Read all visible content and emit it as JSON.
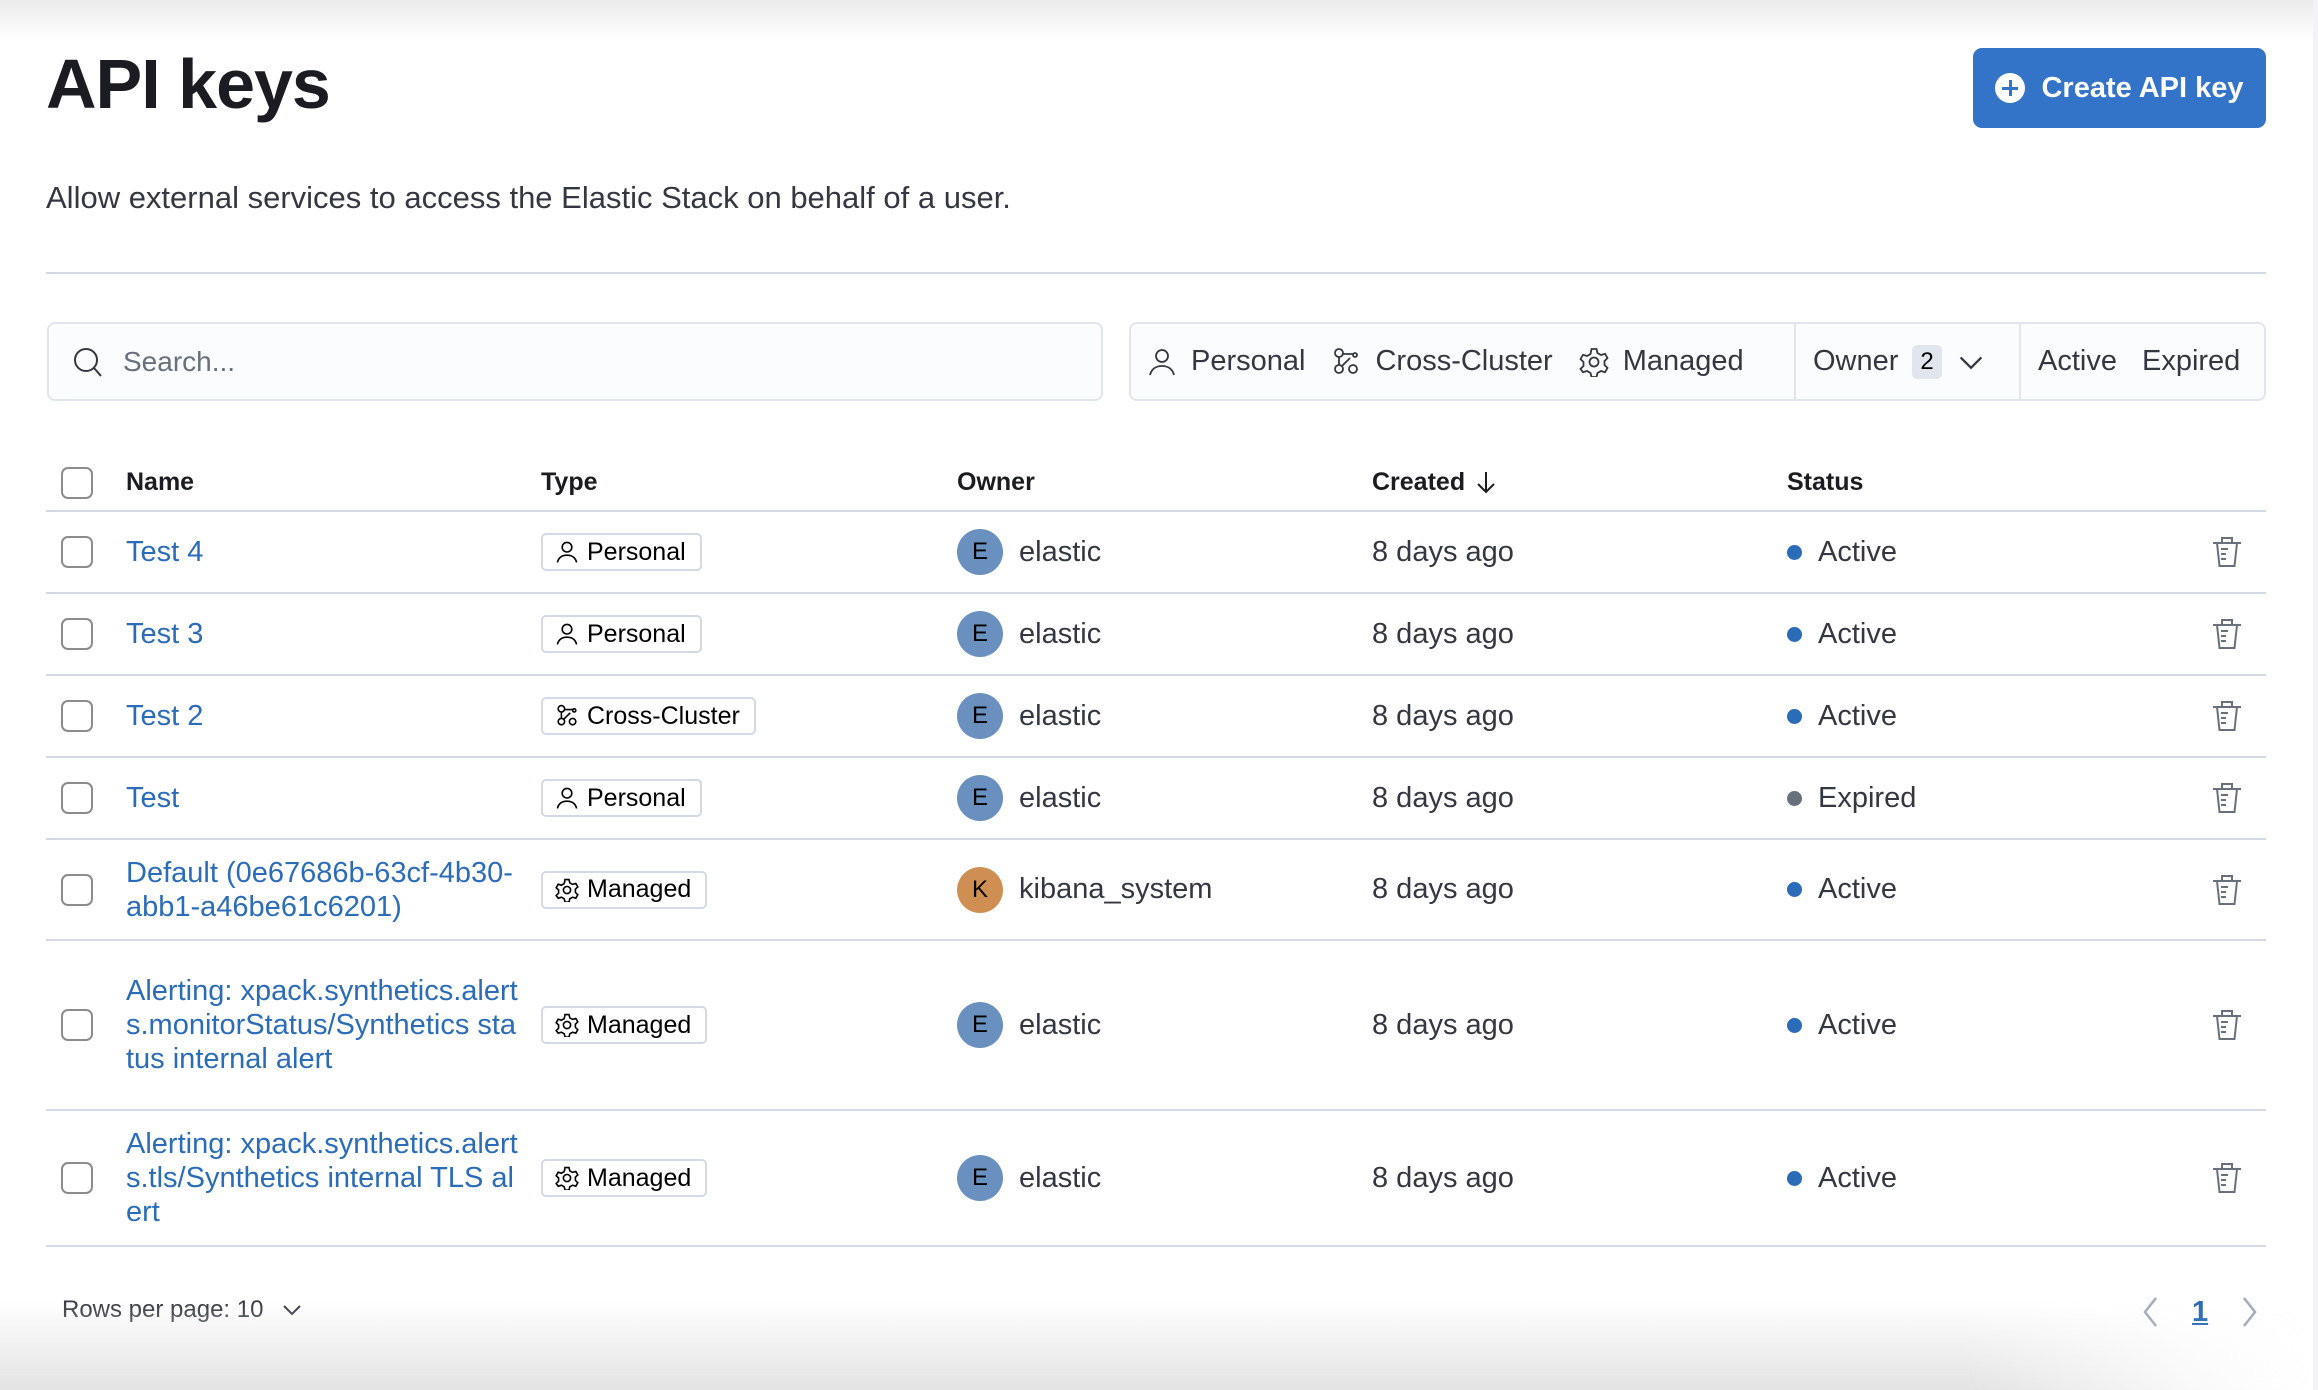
{
  "header": {
    "title": "API keys",
    "subtitle": "Allow external services to access the Elastic Stack on behalf of a user.",
    "create_button": "Create API key"
  },
  "search": {
    "placeholder": "Search...",
    "value": ""
  },
  "filters": {
    "type_filters": [
      {
        "label": "Personal",
        "icon": "user-icon"
      },
      {
        "label": "Cross-Cluster",
        "icon": "cross-cluster-icon"
      },
      {
        "label": "Managed",
        "icon": "gear-icon"
      }
    ],
    "owner": {
      "label": "Owner",
      "count": "2"
    },
    "status_filters": [
      {
        "label": "Active"
      },
      {
        "label": "Expired"
      }
    ]
  },
  "table": {
    "columns": {
      "name": "Name",
      "type": "Type",
      "owner": "Owner",
      "created": "Created",
      "status": "Status"
    },
    "sort": {
      "column": "created",
      "direction": "descending"
    },
    "rows": [
      {
        "name": "Test 4",
        "type": "Personal",
        "owner": "elastic",
        "owner_initial": "E",
        "created": "8 days ago",
        "status": "Active"
      },
      {
        "name": "Test 3",
        "type": "Personal",
        "owner": "elastic",
        "owner_initial": "E",
        "created": "8 days ago",
        "status": "Active"
      },
      {
        "name": "Test 2",
        "type": "Cross-Cluster",
        "owner": "elastic",
        "owner_initial": "E",
        "created": "8 days ago",
        "status": "Active"
      },
      {
        "name": "Test",
        "type": "Personal",
        "owner": "elastic",
        "owner_initial": "E",
        "created": "8 days ago",
        "status": "Expired"
      },
      {
        "name": "Default (0e67686b-63cf-4b30-abb1-a46be61c6201)",
        "type": "Managed",
        "owner": "kibana_system",
        "owner_initial": "K",
        "created": "8 days ago",
        "status": "Active"
      },
      {
        "name": "Alerting: xpack.synthetics.alerts.monitorStatus/Synthetics status internal alert",
        "type": "Managed",
        "owner": "elastic",
        "owner_initial": "E",
        "created": "8 days ago",
        "status": "Active"
      },
      {
        "name": "Alerting: xpack.synthetics.alerts.tls/Synthetics internal TLS alert",
        "type": "Managed",
        "owner": "elastic",
        "owner_initial": "E",
        "created": "8 days ago",
        "status": "Active"
      }
    ]
  },
  "pagination": {
    "rows_per_page_label": "Rows per page: 10",
    "current_page": "1"
  },
  "colors": {
    "primary": "#3373c8",
    "link": "#2b6cb8",
    "status_active": "#2b6cb8",
    "status_expired": "#69707d",
    "avatar_elastic": "#6a90bf",
    "avatar_kibana_system": "#d08f52"
  }
}
